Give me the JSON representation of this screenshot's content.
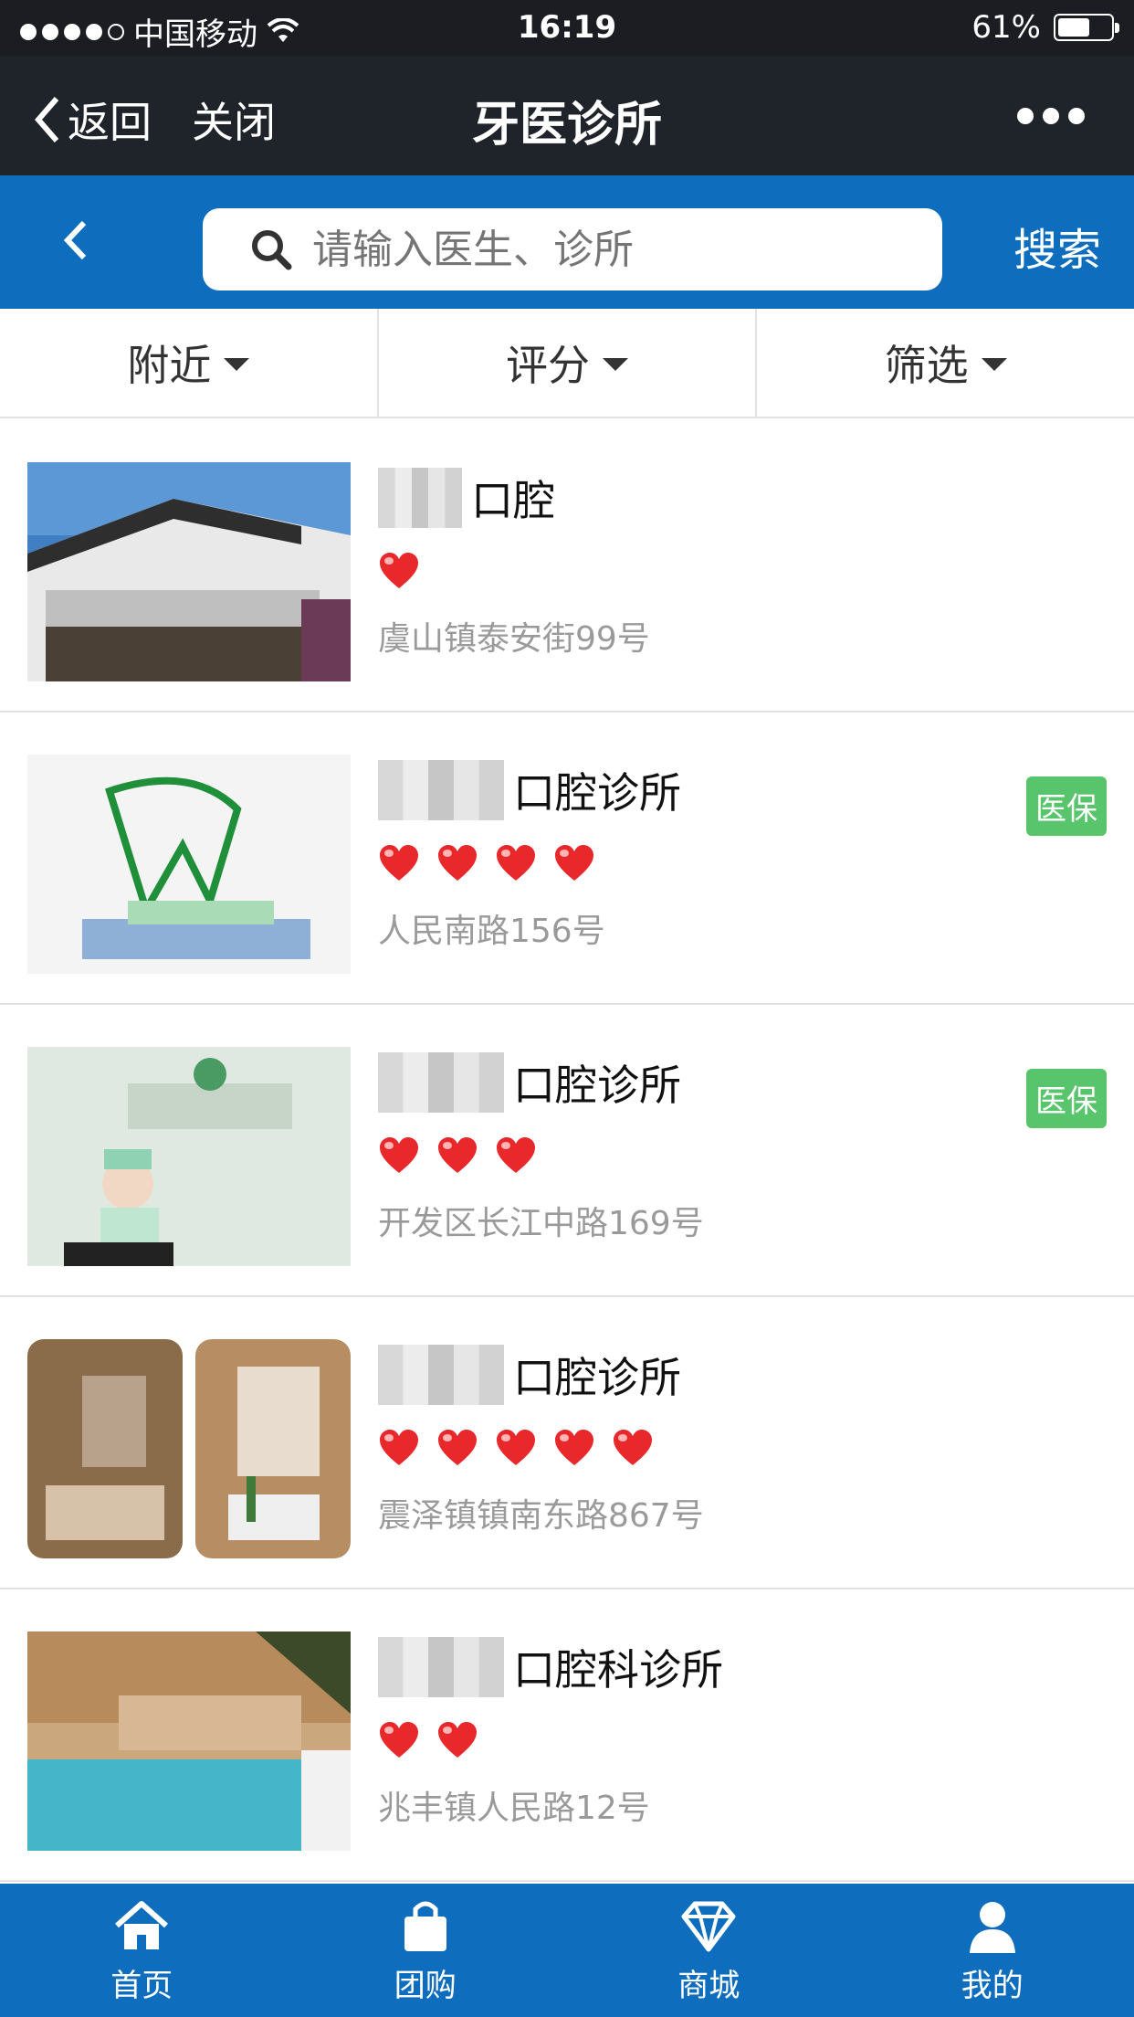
{
  "status_bar": {
    "carrier": "中国移动",
    "time": "16:19",
    "battery": "61%",
    "battery_level": 0.61
  },
  "nav": {
    "back_label": "返回",
    "close_label": "关闭",
    "title": "牙医诊所"
  },
  "search": {
    "placeholder": "请输入医生、诊所",
    "button_label": "搜索"
  },
  "filters": [
    {
      "label": "附近"
    },
    {
      "label": "评分"
    },
    {
      "label": "筛选"
    }
  ],
  "clinics": [
    {
      "name_suffix": "口腔",
      "rating": 1,
      "address": "虞山镇泰安街99号",
      "badge": ""
    },
    {
      "name_suffix": "口腔诊所",
      "rating": 4,
      "address": "人民南路156号",
      "badge": "医保"
    },
    {
      "name_suffix": "口腔诊所",
      "rating": 3,
      "address": "开发区长江中路169号",
      "badge": "医保"
    },
    {
      "name_suffix": "口腔诊所",
      "rating": 5,
      "address": "震泽镇镇南东路867号",
      "badge": ""
    },
    {
      "name_suffix": "口腔科诊所",
      "rating": 2,
      "address": "兆丰镇人民路12号",
      "badge": ""
    }
  ],
  "tabbar": [
    {
      "label": "首页",
      "icon": "home-icon"
    },
    {
      "label": "团购",
      "icon": "shopping-bag-icon"
    },
    {
      "label": "商城",
      "icon": "diamond-icon"
    },
    {
      "label": "我的",
      "icon": "user-icon"
    }
  ],
  "colors": {
    "primary": "#0f6dbd",
    "badge": "#58c46b",
    "heart": "#e8282b"
  }
}
